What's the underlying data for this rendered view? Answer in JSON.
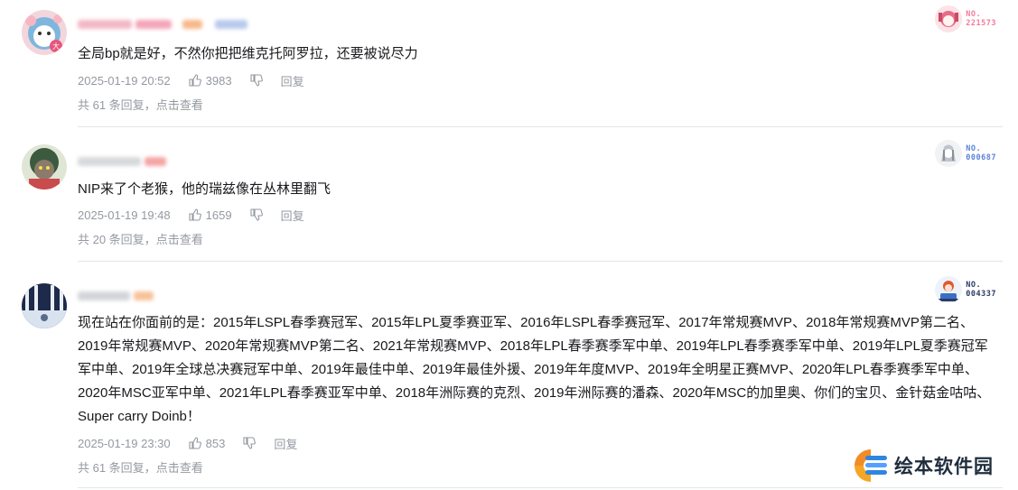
{
  "comments": [
    {
      "badge_no": "NO.\n221573",
      "badge_color": "#f47a9b",
      "text": "全局bp就是好，不然你把把维克托阿罗拉，还要被说尽力",
      "time": "2025-01-19 20:52",
      "likes": "3983",
      "reply_label": "回复",
      "replies_prefix": "共 61 条回复，",
      "replies_link": "点击查看"
    },
    {
      "badge_no": "NO.\n000687",
      "badge_color": "#5a83d6",
      "text": "NIP来了个老猴，他的瑞兹像在丛林里翻飞",
      "time": "2025-01-19 19:48",
      "likes": "1659",
      "reply_label": "回复",
      "replies_prefix": "共 20 条回复，",
      "replies_link": "点击查看"
    },
    {
      "badge_no": "NO.\n004337",
      "badge_color": "#2b3a67",
      "text": "现在站在你面前的是：2015年LSPL春季赛冠军、2015年LPL夏季赛亚军、2016年LSPL春季赛冠军、2017年常规赛MVP、2018年常规赛MVP第二名、2019年常规赛MVP、2020年常规赛MVP第二名、2021年常规赛MVP、2018年LPL春季赛季军中单、2019年LPL春季赛季军中单、2019年LPL夏季赛冠军军中单、2019年全球总决赛冠军中单、2019年最佳中单、2019年最佳外援、2019年年度MVP、2019年全明星正赛MVP、2020年LPL春季赛季军中单、2020年MSC亚军中单、2021年LPL春季赛亚军中单、2018年洲际赛的克烈、2019年洲际赛的潘森、2020年MSC的加里奥、你们的宝贝、金针菇金咕咕、Super carry Doinb！",
      "time": "2025-01-19 23:30",
      "likes": "853",
      "reply_label": "回复",
      "replies_prefix": "共 61 条回复，",
      "replies_link": "点击查看"
    }
  ],
  "watermark": {
    "text": "绘本软件园"
  },
  "colors": {
    "text": "#18191c",
    "meta": "#9499a0",
    "divider": "#e3e5e7"
  }
}
